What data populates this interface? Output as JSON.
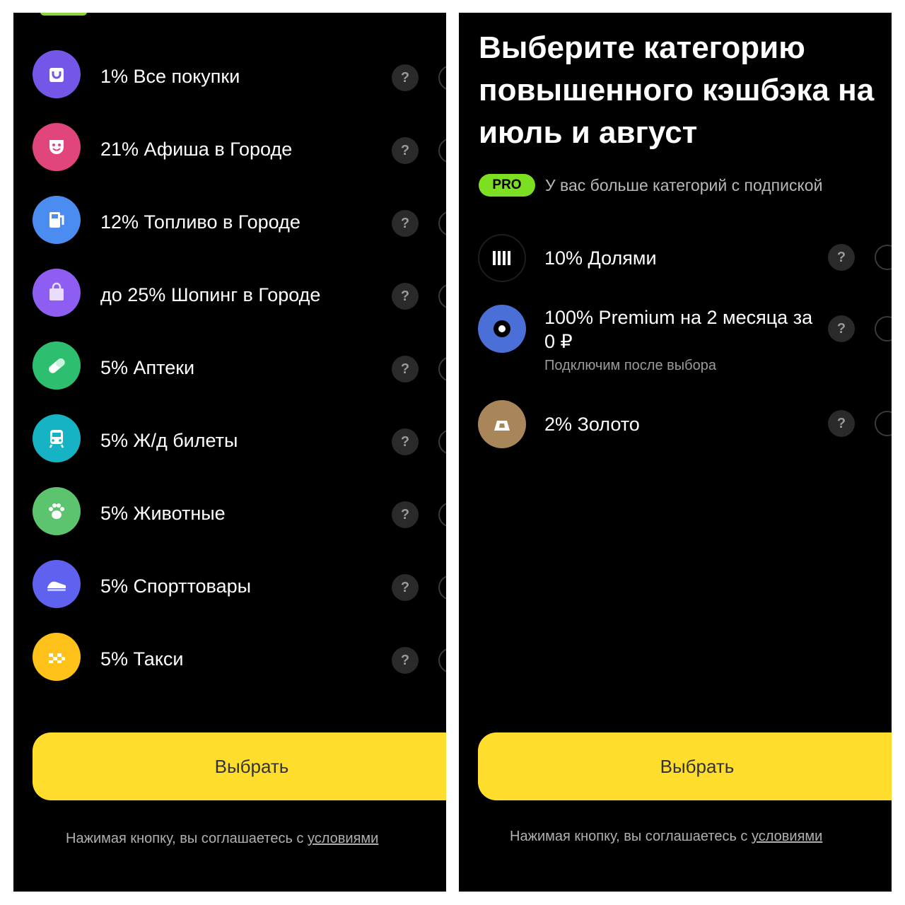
{
  "left": {
    "items": [
      {
        "label": "1% Все покупки",
        "icon": "shopping-bag-icon",
        "color": "#7557e8"
      },
      {
        "label": "21% Афиша в Городе",
        "icon": "theater-mask-icon",
        "color": "#e0467b"
      },
      {
        "label": "12% Топливо в Городе",
        "icon": "fuel-pump-icon",
        "color": "#4b8cf0"
      },
      {
        "label": "до 25% Шопинг в Городе",
        "icon": "bag-icon",
        "color": "#8e5ef2"
      },
      {
        "label": "5% Аптеки",
        "icon": "pill-icon",
        "color": "#2dbf6f"
      },
      {
        "label": "5% Ж/д билеты",
        "icon": "train-icon",
        "color": "#16b3c5"
      },
      {
        "label": "5% Животные",
        "icon": "paw-icon",
        "color": "#5cc46e"
      },
      {
        "label": "5% Спорттовары",
        "icon": "sneaker-icon",
        "color": "#5f62ef"
      },
      {
        "label": "5% Такси",
        "icon": "taxi-checker-icon",
        "color": "#ffc21a"
      }
    ],
    "help_label": "?",
    "button_label": "Выбрать",
    "terms_prefix": "Нажимая кнопку, вы соглашаетесь с ",
    "terms_link": "условиями"
  },
  "right": {
    "title": "Выберите категорию повышенного кэшбэка на июль и август",
    "pro_badge": "PRO",
    "pro_text": "У вас больше категорий с подпиской",
    "items": [
      {
        "label": "10% Долями",
        "icon": "dolyami-icon",
        "color": "#000000"
      },
      {
        "label": "100% Premium на 2 месяца за 0 ₽",
        "sub": "Подключим после выбора",
        "icon": "premium-target-icon",
        "color": "#4a6fd6"
      },
      {
        "label": "2% Золото",
        "icon": "gold-bar-icon",
        "color": "#a8865a"
      }
    ],
    "help_label": "?",
    "button_label": "Выбрать",
    "terms_prefix": "Нажимая кнопку, вы соглашаетесь с ",
    "terms_link": "условиями"
  },
  "colors": {
    "accent": "#ffdd2d",
    "pro": "#7ddf21",
    "background": "#000000"
  }
}
